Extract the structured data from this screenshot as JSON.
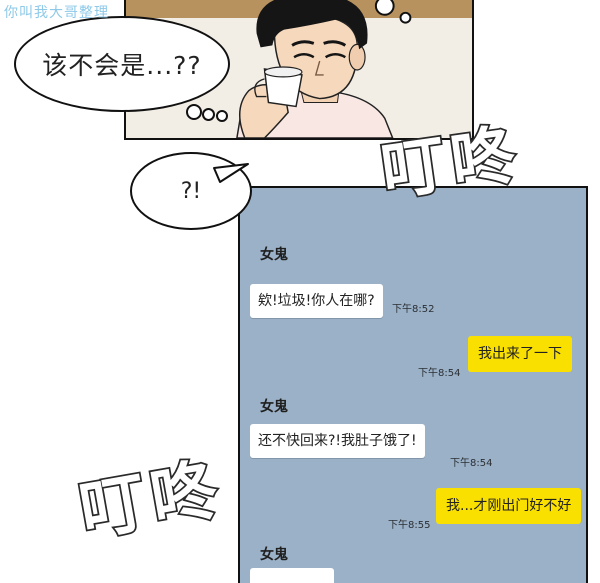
{
  "watermark": "你叫我大哥整理",
  "top_bubble_text": "该不会是...??",
  "small_bubble_text": "?!",
  "sfx_top": "叮咚",
  "sfx_bottom": "叮咚",
  "colors": {
    "chat_bg": "#9ab1c7",
    "incoming_bubble": "#ffffff",
    "outgoing_bubble": "#f9e000",
    "watermark": "#8ec9e8"
  },
  "chat": {
    "messages": [
      {
        "sender": "女鬼",
        "text": "欸!垃圾!你人在哪?",
        "time": "下午8:52",
        "direction": "in"
      },
      {
        "text": "我出来了一下",
        "time": "下午8:54",
        "direction": "out"
      },
      {
        "sender": "女鬼",
        "text": "还不快回来?!我肚子饿了!",
        "time": "下午8:54",
        "direction": "in"
      },
      {
        "text": "我...才刚出门好不好",
        "time": "下午8:55",
        "direction": "out"
      },
      {
        "sender": "女鬼",
        "text": "",
        "direction": "in"
      }
    ]
  }
}
